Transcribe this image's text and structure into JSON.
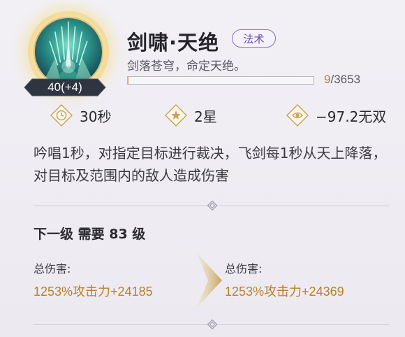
{
  "skill": {
    "name": "剑啸·天绝",
    "type_tag": "法术",
    "subtitle": "剑落苍穹，命定天绝。",
    "level_badge": "40(+4)",
    "progress": {
      "current": "9",
      "separator": "/",
      "max": "3653",
      "fraction": 0.0025
    },
    "icon": "sword-rain-skill-icon"
  },
  "stats": [
    {
      "icon": "clock-icon",
      "value": "30秒"
    },
    {
      "icon": "star-icon",
      "value": "2星"
    },
    {
      "icon": "eye-icon",
      "value": "−97.2无双"
    }
  ],
  "description": "吟唱1秒，对指定目标进行裁决，飞剑每1秒从天上降落，对目标及范围内的敌人造成伤害",
  "upgrade": {
    "next_level_text": "下一级 需要 83 级",
    "current": {
      "label": "总伤害:",
      "value": "1253%攻击力+24185"
    },
    "next": {
      "label": "总伤害:",
      "value": "1253%攻击力+24369"
    }
  },
  "colors": {
    "accent_gold": "#b7812d",
    "tag_purple": "#6b4fae",
    "badge_dark": "#2e3440"
  }
}
